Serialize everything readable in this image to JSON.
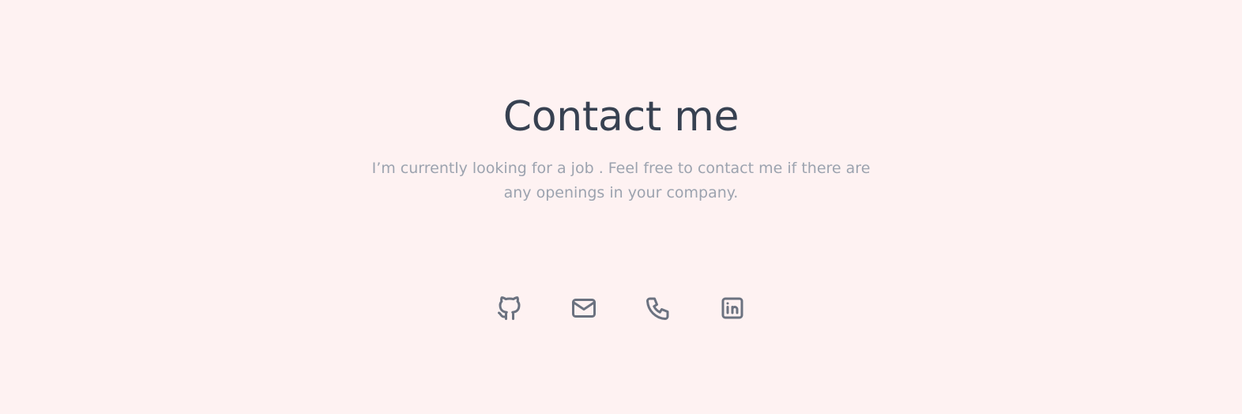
{
  "contact": {
    "title": "Contact me",
    "description": "I’m currently looking for a job . Feel free to contact me if there are any openings in your company."
  },
  "links": [
    {
      "icon": "github-icon"
    },
    {
      "icon": "mail-icon"
    },
    {
      "icon": "phone-icon"
    },
    {
      "icon": "linkedin-icon"
    }
  ],
  "colors": {
    "background": "#fef2f2",
    "heading": "#374151",
    "text": "#9ca3af",
    "icon": "#6b7280"
  }
}
